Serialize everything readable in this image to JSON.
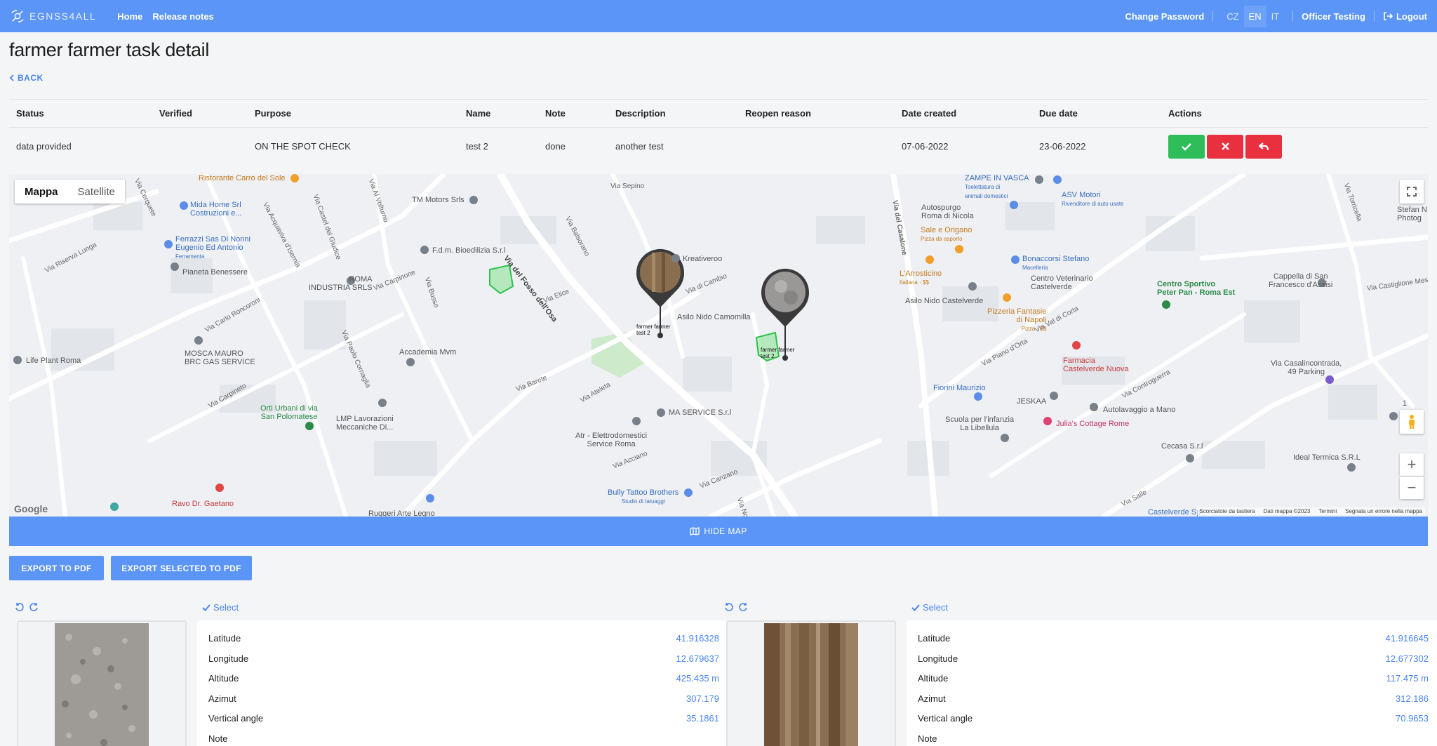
{
  "nav": {
    "brand": "EGNSS4ALL",
    "links": [
      "Home",
      "Release notes"
    ],
    "change_password": "Change Password",
    "languages": [
      "CZ",
      "EN",
      "IT"
    ],
    "active_language": "EN",
    "user": "Officer Testing",
    "logout": "Logout",
    "accent_color": "#5b95f8"
  },
  "page": {
    "title": "farmer farmer task detail",
    "back": "BACK"
  },
  "table": {
    "headers": [
      "Status",
      "Verified",
      "Purpose",
      "Name",
      "Note",
      "Description",
      "Reopen reason",
      "Date created",
      "Due date",
      "Actions"
    ],
    "row": {
      "status": "data provided",
      "verified": "",
      "purpose": "ON THE SPOT CHECK",
      "name": "test 2",
      "note": "done",
      "description": "another test",
      "reopen_reason": "",
      "date_created": "07-06-2022",
      "due_date": "23-06-2022"
    },
    "actions": [
      {
        "icon": "check-icon",
        "color": "#2ebd59"
      },
      {
        "icon": "close-icon",
        "color": "#e8303f"
      },
      {
        "icon": "reply-icon",
        "color": "#e8303f"
      }
    ]
  },
  "map": {
    "toggle": [
      "Mappa",
      "Satellite"
    ],
    "active_toggle": "Mappa",
    "markers": [
      {
        "label_line1": "farmer farmer",
        "label_line2": "test 2"
      },
      {
        "label_line1": "farmer farmer",
        "label_line2": "test 2"
      }
    ],
    "pois": [
      "Ristorante Carro del Sole",
      "Mida Home Srl",
      "Costruzioni e...",
      "Ferrazzi Sas Di Nonni",
      "Eugenio Ed Antonio",
      "Ferramenta",
      "Pianeta Benessere",
      "TM Motors Srls",
      "F.d.m. Bioedilizia S.r.l",
      "ROMA",
      "INDUSTRIA SRLS",
      "Kreativeroo",
      "Asilo Nido Camomilla",
      "MOSCA MAURO",
      "BRC GAS SERVICE",
      "Life Plant Roma",
      "Accademia Mvm",
      "Orti Urbani di via",
      "San Polomatese",
      "LMP Lavorazioni",
      "Meccaniche Di...",
      "MA SERVICE S.r.l",
      "Atr - Elettrodomestici",
      "Service Roma",
      "Bully Tattoo Brothers",
      "Studio di tatuaggi",
      "Ravo Dr. Gaetano",
      "Ruggeri Arte Legno",
      "ZAMPE IN VASCA",
      "Toelettatura di",
      "animali domestici",
      "ASV Motori",
      "Rivenditore di auto usate",
      "Autospurgo",
      "Roma di Nicola",
      "Sale e Origano",
      "Pizza da asporto",
      "Bonaccorsi Stefano",
      "Macelleria",
      "L'Arrosticino",
      "Italiana · $$",
      "Centro Veterinario",
      "Castelverde",
      "Asilo Nido Castelverde",
      "Pizzeria Fantasie",
      "di Napoli",
      "Pizza · $$",
      "Centro Sportivo",
      "Peter Pan - Roma Est",
      "Cappella di San",
      "Francesco d'Assisi",
      "Farmacia",
      "Castelverde Nuova",
      "Fiorini Maurizio",
      "JESKAA",
      "Autolavaggio a Mano",
      "Scuola per l'infanzia",
      "La Libellula",
      "Julia's Cottage Rome",
      "Cecasa S.r.l",
      "Via Casalincontrada,",
      "49 Parking",
      "Ideal Termica S.R.L",
      "Stefan N",
      "Photog",
      "Castelverde Sp"
    ],
    "roads": [
      "Via del Fosso dell'Osa",
      "Via Elice",
      "Via Carpinone",
      "Via Barete",
      "Via Ateleta",
      "Via Acciano",
      "Via Canzano",
      "Via Sepino",
      "Via Balsorano",
      "Via Riserva Lunga",
      "Via Carlo Roncoroni",
      "Via Carpineto",
      "Via Paolo Cornaglia",
      "Via Busso",
      "Via del Casalone",
      "Via Piano d'Orta",
      "Via Val di Corta",
      "Via Controguerra",
      "Via Salle",
      "Via Castiglione Mes",
      "Via Torricella",
      "Via Acquaviva d'Isernia",
      "Via Castel del Giudice",
      "Via Cerquete",
      "Via Al Volturno",
      "Via di Cambio",
      "Via Noia"
    ],
    "footer": [
      "Scorciatoie da tastiera",
      "Dati mappa ©2023",
      "Termini",
      "Segnala un errore nella mappa"
    ],
    "google": "Google",
    "pegman_count": "1"
  },
  "hide_map": "HIDE MAP",
  "exports": {
    "pdf": "EXPORT TO PDF",
    "selected_pdf": "EXPORT SELECTED TO PDF"
  },
  "photos": [
    {
      "select": "Select",
      "rows": [
        {
          "label": "Latitude",
          "value": "41.916328"
        },
        {
          "label": "Longitude",
          "value": "12.679637"
        },
        {
          "label": "Altitude",
          "value": "425.435 m"
        },
        {
          "label": "Azimut",
          "value": "307.179"
        },
        {
          "label": "Vertical angle",
          "value": "35.1861"
        },
        {
          "label": "Note",
          "value": ""
        }
      ]
    },
    {
      "select": "Select",
      "rows": [
        {
          "label": "Latitude",
          "value": "41.916645"
        },
        {
          "label": "Longitude",
          "value": "12.677302"
        },
        {
          "label": "Altitude",
          "value": "117.475 m"
        },
        {
          "label": "Azimut",
          "value": "312.186"
        },
        {
          "label": "Vertical angle",
          "value": "70.9653"
        },
        {
          "label": "Note",
          "value": ""
        }
      ]
    }
  ]
}
